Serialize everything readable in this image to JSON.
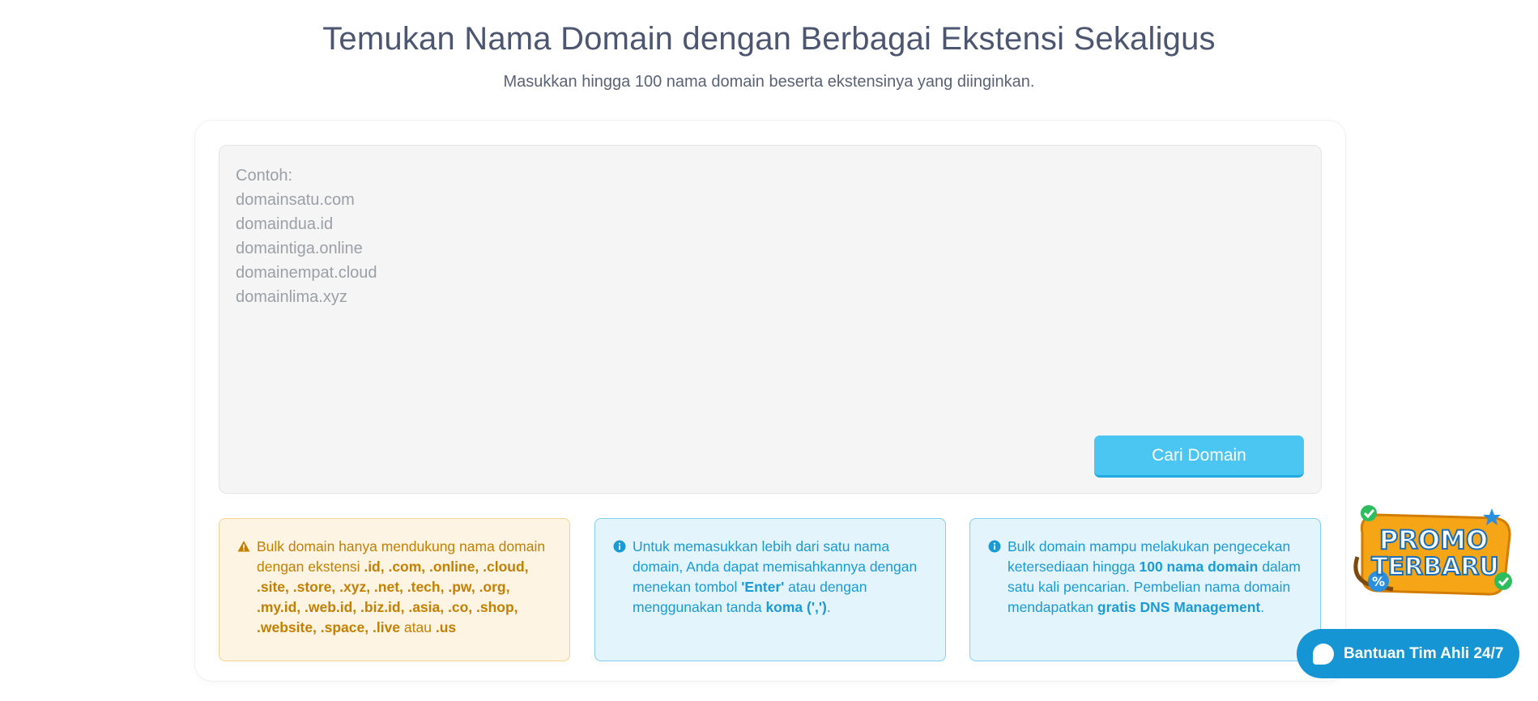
{
  "header": {
    "title": "Temukan Nama Domain dengan Berbagai Ekstensi Sekaligus",
    "subtitle": "Masukkan hingga 100 nama domain beserta ekstensinya yang diinginkan."
  },
  "search": {
    "placeholder": "Contoh:\ndomainsatu.com\ndomaindua.id\ndomaintiga.online\ndomainempat.cloud\ndomainlima.xyz",
    "value": "",
    "button_label": "Cari Domain"
  },
  "info_boxes": {
    "warning": {
      "icon": "warning-icon",
      "text_before": "Bulk domain hanya mendukung nama domain dengan ekstensi ",
      "extensions": ".id, .com, .online, .cloud, .site, .store, .xyz, .net, .tech, .pw, .org, .my.id, .web.id, .biz.id, .asia, .co, .shop, .website, .space, .live",
      "connector": " atau ",
      "last_extension": ".us"
    },
    "separator_tip": {
      "icon": "info-icon",
      "text_1": "Untuk memasukkan lebih dari satu nama domain, Anda dapat memisahkannya dengan menekan tombol ",
      "key_enter": "'Enter'",
      "text_2": " atau dengan menggunakan tanda ",
      "key_comma": "koma (',')",
      "text_3": "."
    },
    "capacity_tip": {
      "icon": "info-icon",
      "text_1": "Bulk domain mampu melakukan pengecekan ketersediaan hingga ",
      "highlight_1": "100 nama domain",
      "text_2": " dalam satu kali pencarian. Pembelian nama domain mendapatkan ",
      "highlight_2": "gratis DNS Management",
      "text_3": "."
    }
  },
  "promo": {
    "line_1": "PROMO",
    "line_2": "TERBARU"
  },
  "help": {
    "label": "Bantuan Tim Ahli 24/7",
    "icon": "chat-icon"
  },
  "colors": {
    "accent": "#4bc5f2",
    "warning_text": "#c38000",
    "info_text": "#1a9ad6",
    "help_button": "#1595d3"
  }
}
